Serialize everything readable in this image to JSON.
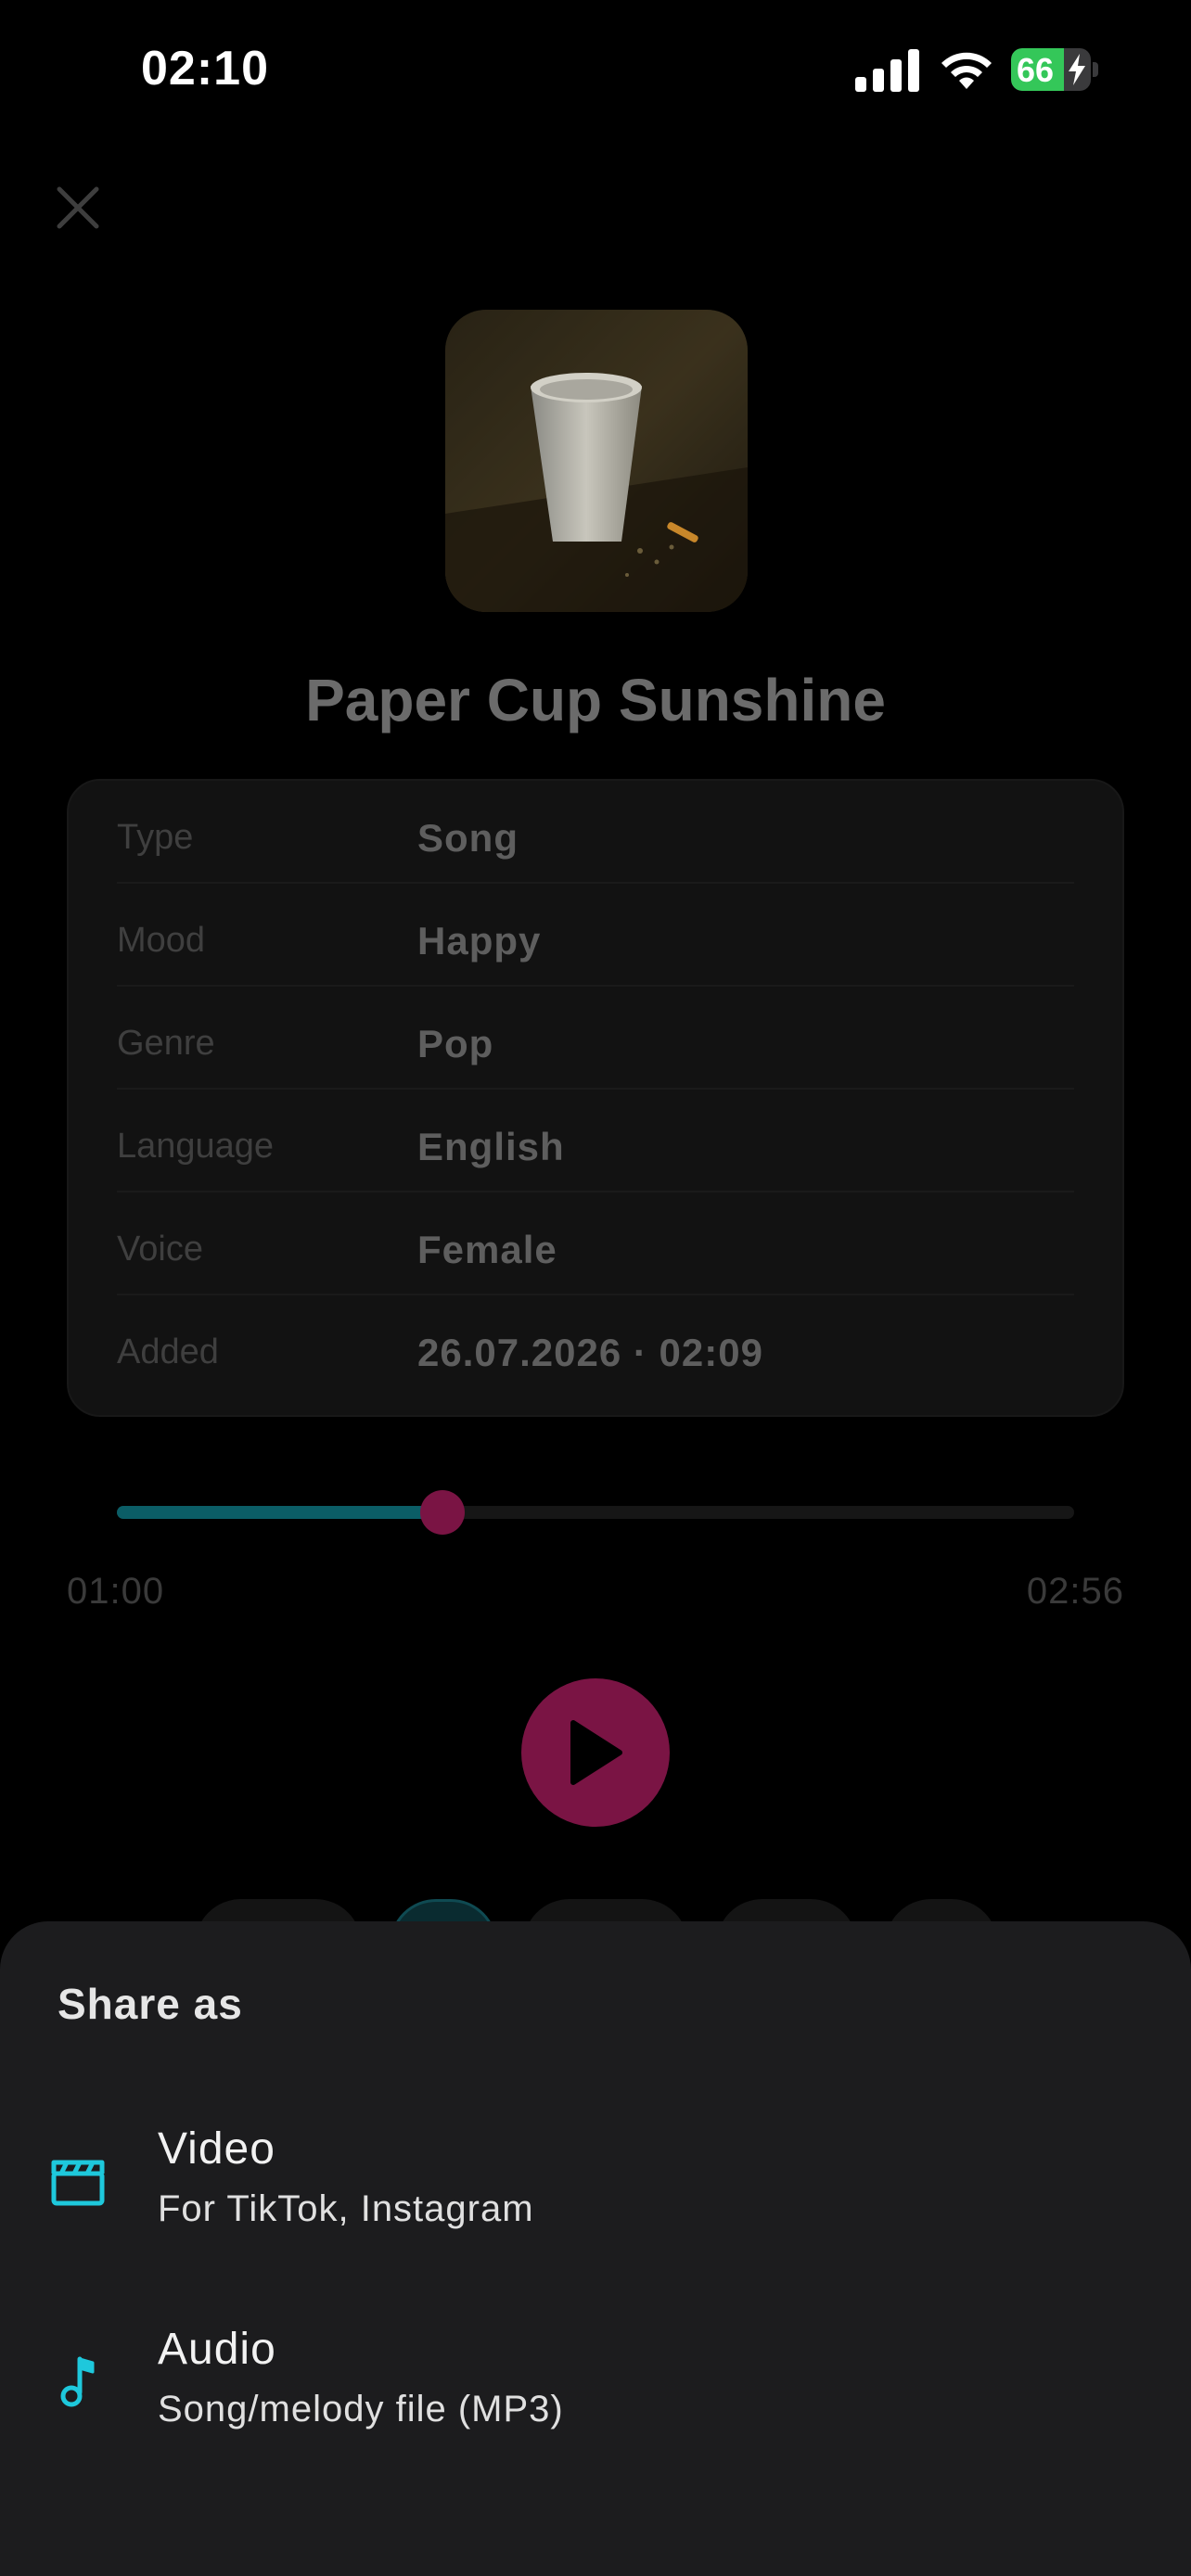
{
  "status_bar": {
    "time": "02:10",
    "battery_level": "66",
    "battery_fraction": 0.66,
    "icons": [
      "cellular-signal-icon",
      "wifi-icon",
      "battery-charging-icon"
    ]
  },
  "player": {
    "close_icon": "close-icon",
    "artwork_alt": "paper-cup-artwork",
    "title": "Paper Cup Sunshine",
    "details": [
      {
        "label": "Type",
        "value": "Song"
      },
      {
        "label": "Mood",
        "value": "Happy"
      },
      {
        "label": "Genre",
        "value": "Pop"
      },
      {
        "label": "Language",
        "value": "English"
      },
      {
        "label": "Voice",
        "value": "Female"
      },
      {
        "label": "Added",
        "value": "26.07.2026 · 02:09"
      }
    ],
    "progress": {
      "elapsed": "01:00",
      "total": "02:56",
      "fraction": 0.34
    },
    "play_icon": "play-icon"
  },
  "share_sheet": {
    "title": "Share as",
    "options": [
      {
        "icon": "clapperboard-icon",
        "title": "Video",
        "subtitle": "For TikTok, Instagram"
      },
      {
        "icon": "music-note-icon",
        "title": "Audio",
        "subtitle": "Song/melody file (MP3)"
      }
    ]
  },
  "colors": {
    "accent_cyan": "#1ec8dc",
    "play_magenta": "#7a1444",
    "progress_teal": "#0b5d66",
    "sheet_bg": "#1c1c1e",
    "battery_green": "#34c759"
  }
}
